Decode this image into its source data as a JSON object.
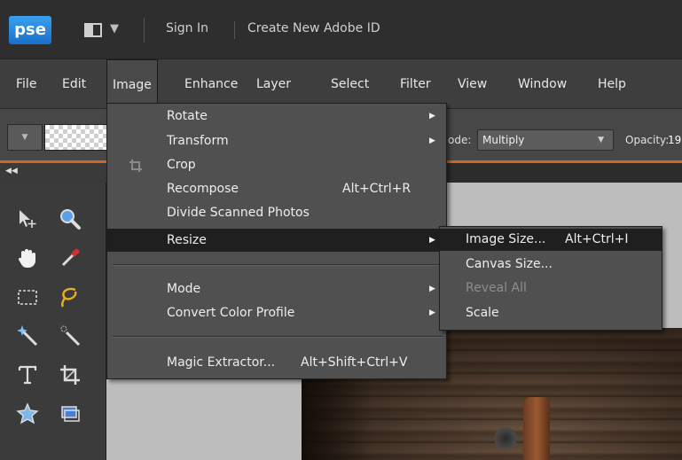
{
  "header": {
    "logo_text": "pse",
    "sign_in": "Sign In",
    "create_id": "Create New Adobe ID"
  },
  "menubar": [
    {
      "label": "File"
    },
    {
      "label": "Edit"
    },
    {
      "label": "Image"
    },
    {
      "label": "Enhance"
    },
    {
      "label": "Layer"
    },
    {
      "label": "Select"
    },
    {
      "label": "Filter"
    },
    {
      "label": "View"
    },
    {
      "label": "Window"
    },
    {
      "label": "Help"
    }
  ],
  "options": {
    "mode_label": "ode:",
    "mode_value": "Multiply",
    "opacity_label": "Opacity:",
    "opacity_value": "19"
  },
  "image_menu": {
    "rotate": "Rotate",
    "transform": "Transform",
    "crop": "Crop",
    "recompose": "Recompose",
    "recompose_shortcut": "Alt+Ctrl+R",
    "divide": "Divide Scanned Photos",
    "resize": "Resize",
    "mode": "Mode",
    "convert": "Convert Color Profile",
    "magic": "Magic Extractor...",
    "magic_shortcut": "Alt+Shift+Ctrl+V"
  },
  "resize_submenu": {
    "image_size": "Image Size...",
    "image_size_shortcut": "Alt+Ctrl+I",
    "canvas_size": "Canvas Size...",
    "reveal_all": "Reveal All",
    "scale": "Scale"
  },
  "colors": {
    "accent_orange": "#d4651e",
    "menu_bg": "#505050",
    "highlight": "#1f1f1f",
    "workspace": "#bdbdbd"
  }
}
